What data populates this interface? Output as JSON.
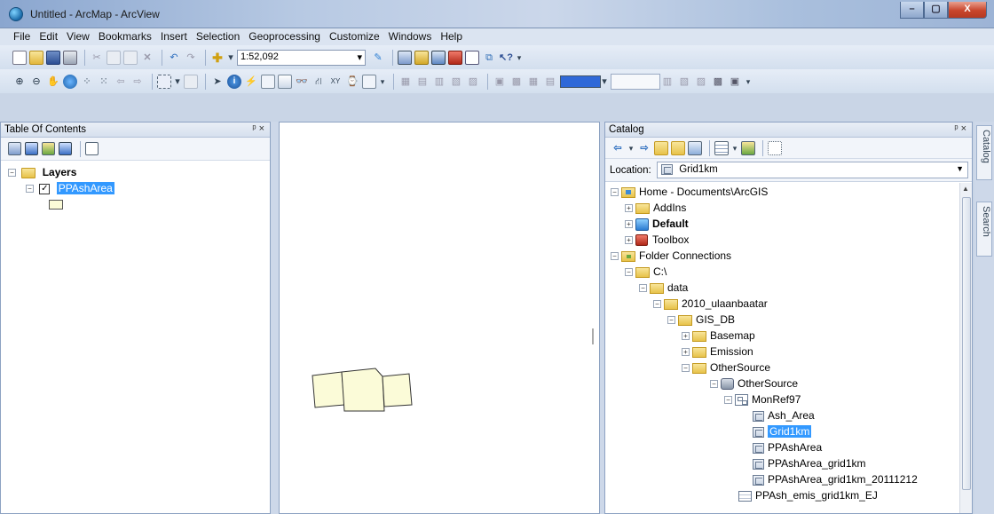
{
  "window": {
    "title": "Untitled - ArcMap - ArcView",
    "min": "–",
    "max": "▢",
    "close": "X"
  },
  "menu": [
    "File",
    "Edit",
    "View",
    "Bookmarks",
    "Insert",
    "Selection",
    "Geoprocessing",
    "Customize",
    "Windows",
    "Help"
  ],
  "toolbar": {
    "scale_value": "1:52,092"
  },
  "toc": {
    "title": "Table Of Contents",
    "pin": "ᵖ ×",
    "root_layer": "Layers",
    "layer_name": "PPAshArea",
    "layer_checked": "✓"
  },
  "catalog": {
    "title": "Catalog",
    "pin": "ᵖ ×",
    "location_label": "Location:",
    "location_value": "Grid1km",
    "tree": {
      "home": "Home - Documents\\ArcGIS",
      "addins": "AddIns",
      "default": "Default",
      "toolbox": "Toolbox",
      "folder_connections": "Folder Connections",
      "c_drive": "C:\\",
      "data": "data",
      "ulaanbaatar": "2010_ulaanbaatar",
      "gis_db": "GIS_DB",
      "basemap": "Basemap",
      "emission": "Emission",
      "othersource": "OtherSource",
      "othersource_gdb": "OtherSource",
      "monref97": "MonRef97",
      "ash_area": "Ash_Area",
      "grid1km": "Grid1km",
      "ppasharea": "PPAshArea",
      "ppasharea_grid1km": "PPAshArea_grid1km",
      "ppasharea_grid1km_2011": "PPAshArea_grid1km_20111212",
      "ppash_emis": "PPAsh_emis_grid1km_EJ"
    }
  },
  "side_tabs": {
    "catalog": "Catalog",
    "search": "Search"
  }
}
